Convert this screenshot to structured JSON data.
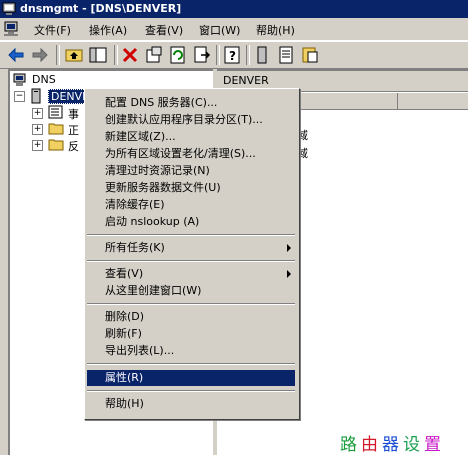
{
  "window": {
    "title": "dnsmgmt - [DNS\\DENVER]"
  },
  "menubar": {
    "items": [
      {
        "label": "文件(F)"
      },
      {
        "label": "操作(A)"
      },
      {
        "label": "查看(V)"
      },
      {
        "label": "窗口(W)"
      },
      {
        "label": "帮助(H)"
      }
    ]
  },
  "toolbar": {
    "buttons": [
      "back-icon",
      "forward-icon",
      "up-folder-icon",
      "console-tree-icon",
      "delete-icon",
      "properties-icon",
      "refresh-icon",
      "export-icon",
      "help-icon",
      "server-icon",
      "list-icon",
      "records-icon"
    ]
  },
  "tree": {
    "root_label": "DNS",
    "server_label": "DENVER",
    "children": [
      {
        "label": "事"
      },
      {
        "label": "正"
      },
      {
        "label": "反"
      }
    ]
  },
  "rightpane": {
    "header": "DENVER",
    "row1_suffix": "域",
    "row2_suffix": "域"
  },
  "context_menu": {
    "items": [
      {
        "label": "配置 DNS 服务器(C)..."
      },
      {
        "label": "创建默认应用程序目录分区(T)..."
      },
      {
        "label": "新建区域(Z)..."
      },
      {
        "label": "为所有区域设置老化/清理(S)..."
      },
      {
        "label": "清理过时资源记录(N)"
      },
      {
        "label": "更新服务器数据文件(U)"
      },
      {
        "label": "清除缓存(E)"
      },
      {
        "label": "启动 nslookup (A)"
      },
      {
        "label": "所有任务(K)"
      },
      {
        "label": "查看(V)"
      },
      {
        "label": "从这里创建窗口(W)"
      },
      {
        "label": "删除(D)"
      },
      {
        "label": "刷新(F)"
      },
      {
        "label": "导出列表(L)..."
      },
      {
        "label": "属性(R)"
      },
      {
        "label": "帮助(H)"
      }
    ],
    "selected": "属性(R)"
  },
  "watermark": "路由器设置",
  "colors": {
    "titlebar": "#0a246a",
    "face": "#d4d0c8",
    "highlight": "#0a246a",
    "watermark": [
      "#1a9c3c",
      "#d4182a",
      "#1a4fd4",
      "#1aa050",
      "#c818c8"
    ]
  }
}
